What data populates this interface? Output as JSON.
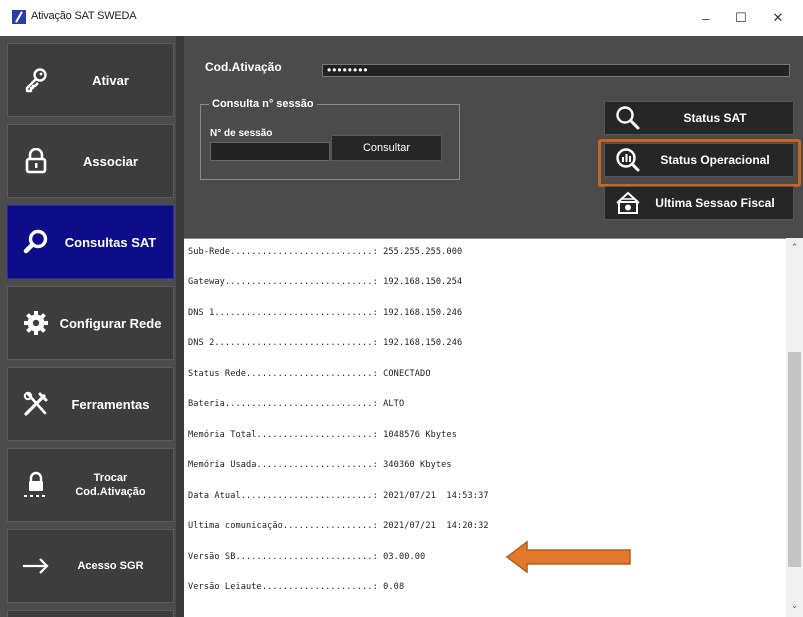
{
  "window": {
    "title": "Ativação SAT SWEDA",
    "minimize": "–",
    "maximize": "☐",
    "close": "✕"
  },
  "sidebar": {
    "items": [
      {
        "label": "Ativar",
        "icon": "key-icon"
      },
      {
        "label": "Associar",
        "icon": "padlock-icon"
      },
      {
        "label": "Consultas SAT",
        "icon": "magnifier-icon",
        "active": true
      },
      {
        "label": "Configurar Rede",
        "icon": "gear-icon"
      },
      {
        "label": "Ferramentas",
        "icon": "tools-icon"
      },
      {
        "label_line1": "Trocar",
        "label_line2": "Cod.Ativação",
        "icon": "lock-password-icon"
      },
      {
        "label": "Acesso SGR",
        "icon": "arrow-right-icon"
      }
    ]
  },
  "form": {
    "cod_label": "Cod.Ativação",
    "cod_value": "••••••••",
    "session_group_title": "Consulta n° sessão",
    "session_label": "N° de sessão",
    "session_value": "",
    "consult_button": "Consultar"
  },
  "actions": {
    "status_sat": "Status SAT",
    "status_operacional": "Status Operacional",
    "ultima_sessao": "Ultima Sessao Fiscal",
    "highlight_color": "#c8661f"
  },
  "console": {
    "lines": [
      "Sub-Rede...........................: 255.255.255.000",
      "Gateway............................: 192.168.150.254",
      "DNS 1..............................: 192.168.150.246",
      "DNS 2..............................: 192.168.150.246",
      "Status Rede........................: CONECTADO",
      "Bateria............................: ALTO",
      "Memória Total......................: 1048576 Kbytes",
      "Memória Usada......................: 340360 Kbytes",
      "Data Atual.........................: 2021/07/21  14:53:37",
      "Ultima comunicação.................: 2021/07/21  14:20:32",
      "Versão SB..........................: 03.00.00",
      "Versão Leiaute.....................: 0.08"
    ],
    "arrow_color": "#e07a2a"
  },
  "colors": {
    "sidebar_bg": "#4b4b4b",
    "active_bg": "#0d0d8a",
    "button_bg": "#262626"
  }
}
